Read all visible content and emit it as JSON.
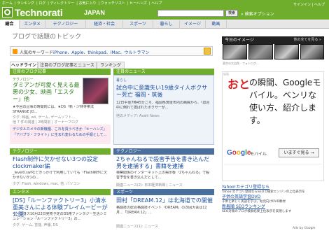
{
  "header": {
    "top_links": [
      "ホーム",
      "ランキング",
      "ログ",
      "ディレクトリー",
      "お気に入り",
      "ウォッチリスト",
      "ヒーハンズ",
      "ヘルプ"
    ],
    "right_links": "サインイン | ヘルプ",
    "logo_main": "Technorati",
    "logo_sub": "JAPAN",
    "search_value": "",
    "search_button": "検索",
    "search_options": "» 検索オプション"
  },
  "nav": [
    "総合",
    "エンタメ",
    "テクノロジー",
    "経済・社会",
    "スポーツ",
    "暮らし",
    "イメージ",
    "動画"
  ],
  "page_title": "ブログで話題のトピック",
  "keywords": {
    "label": "人気のキーワード",
    "words": "iPhone、Apple、thinkpad、iMac、ウルトラマン"
  },
  "tabs": [
    "ヘッドライン",
    "注目のブログ記事とニュース",
    "ランキング"
  ],
  "left_col": {
    "header": "注目のブログ記事",
    "card1": {
      "category": "テクノロジー",
      "title": "ダミアンが可愛く見える最悪の少女、映画「エスター」他",
      "body": "★今回の記事の時間的には、★DS「新・少林寺拳法 STRANGE JO...",
      "tags": "タグ: 映画, wii, ゲーム, ゲームソフト...",
      "meta": "他 7 件の関連 | 2時間前 | オーナーブログ",
      "related": "デジタルカメラの新機種、これを買うべきか「ヒーハンズ」",
      "related2": "「アバプラ・フライト」に生まれ変わるための手順として..."
    },
    "card2": {
      "category": "テクノロジー",
      "title": "Flash制作に欠かせない3つの設定 clockmaker編",
      "body": "_level0.swfなどきっかけで利用していても「Flash制作に欠かせない3つの...",
      "tags": "タグ: Flash, windows, mac, 他, パソコン"
    },
    "card3": {
      "category": "エンタメ",
      "title": "[DS]「ルーンファクトリー3」小清水亜美さんによる体験プレイムービーが公開！",
      "body": "マーベラス10月22日発売予定のDS用ファンタジー生活シミュレーション「ルーンファクトリー3」の...",
      "tags": "タグ: ゲーム, 芸能, 声優, DS"
    }
  },
  "mid_col": {
    "header": "注目のニュース",
    "card1": {
      "category": "暮らし",
      "title": "試合中に意識失い19歳タイ人ボクサー死亡 福岡・筑後",
      "body": "12日午後7時45分ごろ、福岡県筑後市内の病院から、「試合中に倒れて運ばれたボクサーが...",
      "meta": "他のメディア: Asahi News"
    },
    "card2": {
      "category": "テクノロジー",
      "title": "2ちゃんねるで殺害予告を書き込んだ男を逮捕する」書籍を逮捕",
      "body": "検察関係のインターネット上の掲示板「2ちゃんねる」で殺害予告を書き込んだとして...",
      "meta": "関連ニュース(2): 日本経済新聞 | ニュース"
    },
    "card3": {
      "category": "スポーツ",
      "title": "田村「DREAM.12」は北海道での開催",
      "body": "格闘技の総合格闘技イベント「DREAM」の次回大会は12月...「DREAM.12」...",
      "meta": "関連ニュース(1): ニュース"
    }
  },
  "right_col": {
    "today_label": "今日のイメージ",
    "today_note": "他の全てを見る »",
    "caption": "東京の大自然 - フォトログ...",
    "ad": {
      "label": "広告",
      "head": "おと",
      "copy": "の瞬間、Googleモバイル。ベンリな使い方、紹介します。",
      "google": "Google",
      "mobile": "モバイル",
      "button": "いますぐ見る →"
    },
    "text_ads": [
      {
        "title": "Yahoo!カテゴリ登録なら",
        "body": "Yahoo!カテゴリ登録ならSEOで検索エンジンの上位表示を",
        "url": "yahoo.co.jp"
      },
      {
        "title": "子供の英語学習DVD",
        "body": "子供と楽しく英語を学ぶ。幼児向けDVD教材",
        "url": "www.kodomo.com"
      },
      {
        "title": "新着順 SEOランキング",
        "body": "SEO対策のプロが検索結果上位表示を実現します",
        "url": "www.seo.com"
      },
      {
        "title": "SEOは分子を上手く使おう",
        "body": "SEOで検索上位を狙うなら今すぐ",
        "url": "www.seo-pro.jp"
      }
    ],
    "adsby": "Ads by Google"
  }
}
